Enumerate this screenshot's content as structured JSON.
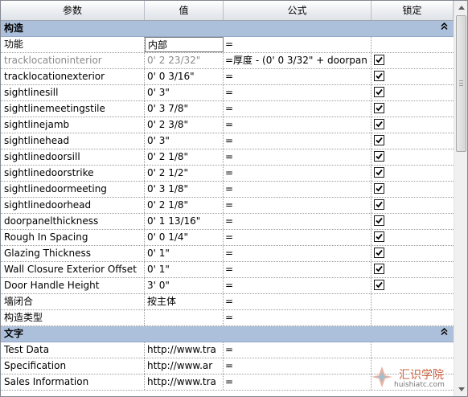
{
  "columns": [
    "参数",
    "值",
    "公式",
    "锁定"
  ],
  "groups": [
    {
      "title": "构造",
      "rows": [
        {
          "name": "功能",
          "value": "内部",
          "formula": "=",
          "locked": null,
          "editing": true
        },
        {
          "name": "tracklocationinterior",
          "value": "0'  2 23/32\"",
          "formula": "=厚度 - (0'  0 3/32\" + doorpan",
          "locked": true,
          "grey": true
        },
        {
          "name": "tracklocationexterior",
          "value": "0'  0 3/16\"",
          "formula": "=",
          "locked": true
        },
        {
          "name": "sightlinesill",
          "value": "0'  3\"",
          "formula": "=",
          "locked": true
        },
        {
          "name": "sightlinemeetingstile",
          "value": "0'  3 7/8\"",
          "formula": "=",
          "locked": true
        },
        {
          "name": "sightlinejamb",
          "value": "0'  2 3/8\"",
          "formula": "=",
          "locked": true
        },
        {
          "name": "sightlinehead",
          "value": "0'  3\"",
          "formula": "=",
          "locked": true
        },
        {
          "name": "sightlinedoorsill",
          "value": "0'  2 1/8\"",
          "formula": "=",
          "locked": true
        },
        {
          "name": "sightlinedoorstrike",
          "value": "0'  2 1/2\"",
          "formula": "=",
          "locked": true
        },
        {
          "name": "sightlinedoormeeting",
          "value": "0'  3 1/8\"",
          "formula": "=",
          "locked": true
        },
        {
          "name": "sightlinedoorhead",
          "value": "0'  2 1/8\"",
          "formula": "=",
          "locked": true
        },
        {
          "name": "doorpanelthickness",
          "value": "0'  1 13/16\"",
          "formula": "=",
          "locked": true
        },
        {
          "name": "Rough In Spacing",
          "value": "0'  0 1/4\"",
          "formula": "=",
          "locked": true
        },
        {
          "name": "Glazing Thickness",
          "value": "0'  1\"",
          "formula": "=",
          "locked": true
        },
        {
          "name": "Wall Closure Exterior Offset",
          "value": "0'  1\"",
          "formula": "=",
          "locked": true
        },
        {
          "name": "Door Handle Height",
          "value": "3'  0\"",
          "formula": "=",
          "locked": true
        },
        {
          "name": "墙闭合",
          "value": "按主体",
          "formula": "=",
          "locked": null
        },
        {
          "name": "构造类型",
          "value": "",
          "formula": "=",
          "locked": null
        }
      ]
    },
    {
      "title": "文字",
      "rows": [
        {
          "name": "Test Data",
          "value": "http://www.tra",
          "formula": "=",
          "locked": null
        },
        {
          "name": "Specification",
          "value": "http://www.ar",
          "formula": "=",
          "locked": null
        },
        {
          "name": "Sales Information",
          "value": "http://www.tra",
          "formula": "=",
          "locked": null
        }
      ]
    }
  ],
  "watermark": {
    "text": "汇识学院",
    "url": "huishiatc.com"
  },
  "icons": {
    "collapse": "double-chevron-up-icon",
    "check": "checkmark-icon"
  }
}
